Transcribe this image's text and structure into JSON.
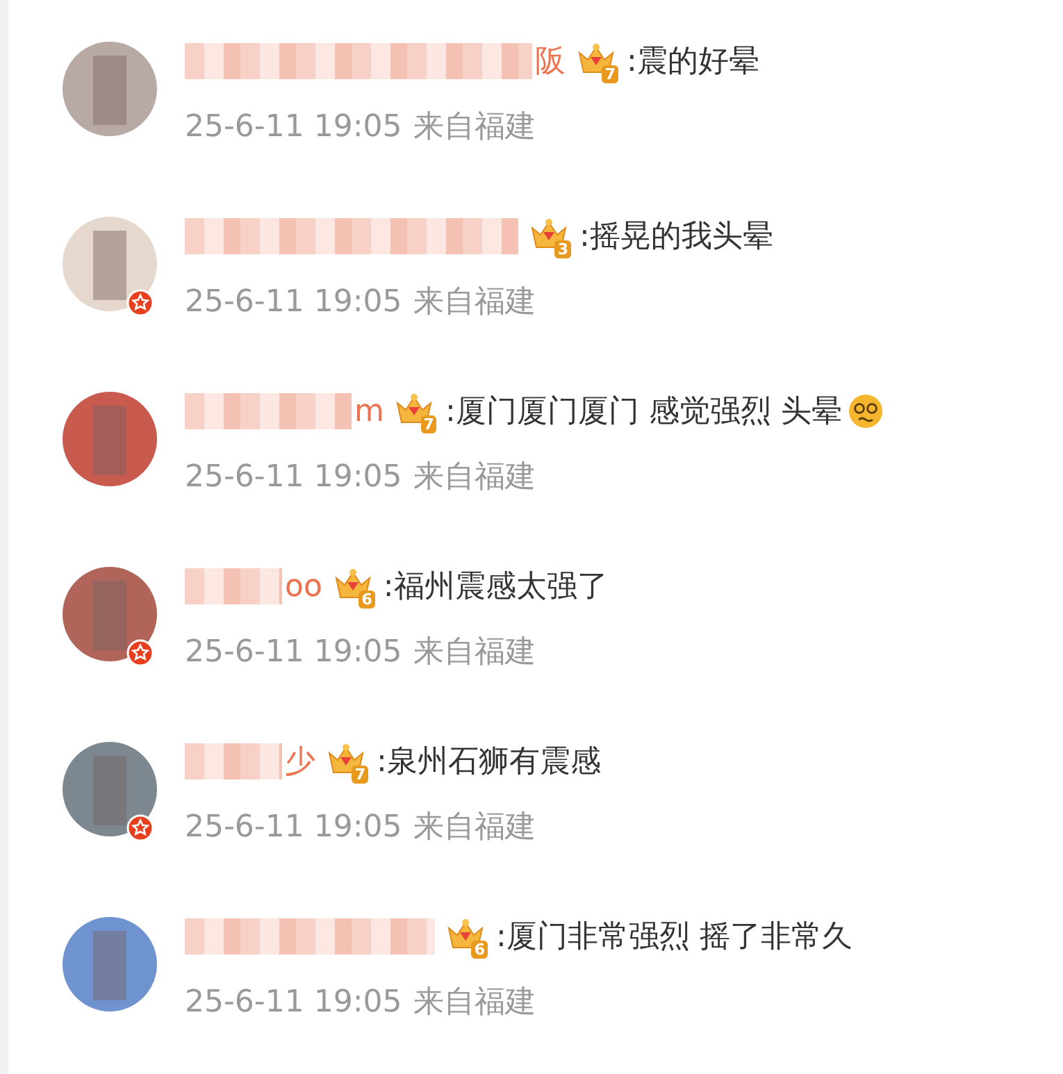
{
  "comments": [
    {
      "name_visible": "阪",
      "crown_level": "7",
      "verified": false,
      "text": ":震的好晕",
      "trailing_emoji": false,
      "time": "25-6-11 19:05",
      "location": "来自福建"
    },
    {
      "crown_level": "3",
      "verified": true,
      "text": ":摇晃的我头晕",
      "trailing_emoji": false,
      "time": "25-6-11 19:05",
      "location": "来自福建"
    },
    {
      "name_visible": "m",
      "crown_level": "7",
      "verified": false,
      "text": ":厦门厦门厦门 感觉强烈 头晕",
      "trailing_emoji": true,
      "time": "25-6-11 19:05",
      "location": "来自福建"
    },
    {
      "name_visible": "oo",
      "crown_level": "6",
      "verified": true,
      "text": ":福州震感太强了",
      "trailing_emoji": false,
      "time": "25-6-11 19:05",
      "location": "来自福建"
    },
    {
      "name_visible": "少",
      "crown_level": "7",
      "verified": true,
      "text": ":泉州石狮有震感",
      "trailing_emoji": false,
      "time": "25-6-11 19:05",
      "location": "来自福建"
    },
    {
      "crown_level": "6",
      "verified": false,
      "text": ":厦门非常强烈 摇了非常久",
      "trailing_emoji": false,
      "time": "25-6-11 19:05",
      "location": "来自福建"
    }
  ]
}
